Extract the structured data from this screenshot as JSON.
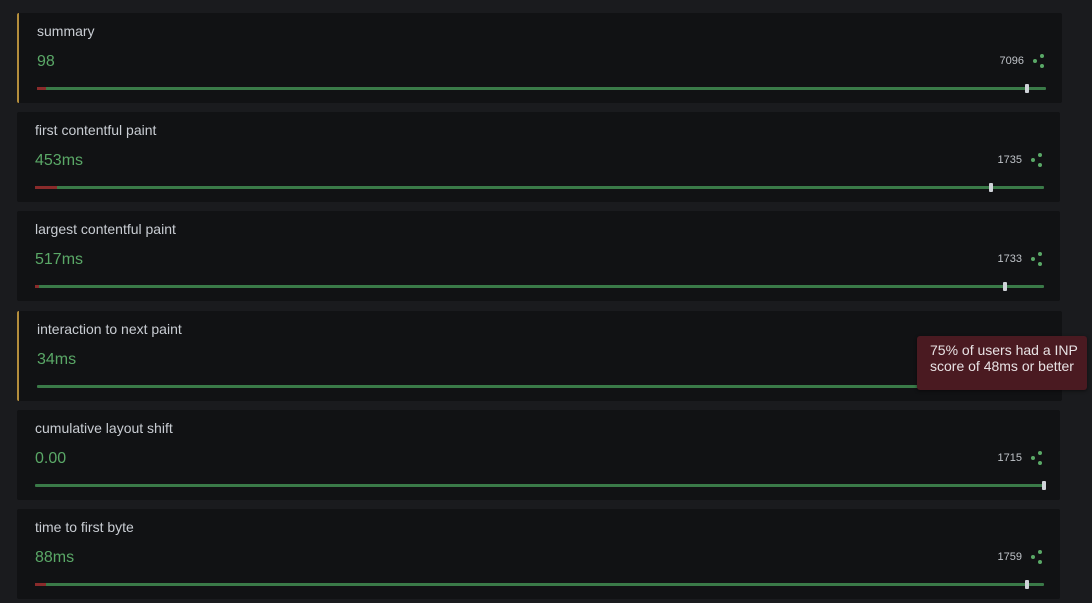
{
  "metrics": [
    {
      "title": "summary",
      "value": "98",
      "count": "7096",
      "highlight": true,
      "show_count": true,
      "marker_fraction": 0.981,
      "poor_fraction": 0.009
    },
    {
      "title": "first contentful paint",
      "value": "453ms",
      "count": "1735",
      "highlight": false,
      "show_count": true,
      "marker_fraction": 0.947,
      "poor_fraction": 0.022
    },
    {
      "title": "largest contentful paint",
      "value": "517ms",
      "count": "1733",
      "highlight": false,
      "show_count": true,
      "marker_fraction": 0.961,
      "poor_fraction": 0.004
    },
    {
      "title": "interaction to next paint",
      "value": "34ms",
      "count": "",
      "highlight": true,
      "show_count": false,
      "marker_fraction": null,
      "poor_fraction": 0
    },
    {
      "title": "cumulative layout shift",
      "value": "0.00",
      "count": "1715",
      "highlight": false,
      "show_count": true,
      "marker_fraction": 1.0,
      "poor_fraction": 0
    },
    {
      "title": "time to first byte",
      "value": "88ms",
      "count": "1759",
      "highlight": false,
      "show_count": true,
      "marker_fraction": 0.983,
      "poor_fraction": 0.011
    }
  ],
  "tooltip": {
    "text": "75% of users had a INP score of 48ms or better"
  },
  "icons": {
    "share": "share-icon"
  },
  "colors": {
    "good": "#5aa867",
    "track": "#3a7a48",
    "poor": "#8a2b2b",
    "highlight": "#b38d3c",
    "tooltip_bg": "#4a1a21"
  }
}
